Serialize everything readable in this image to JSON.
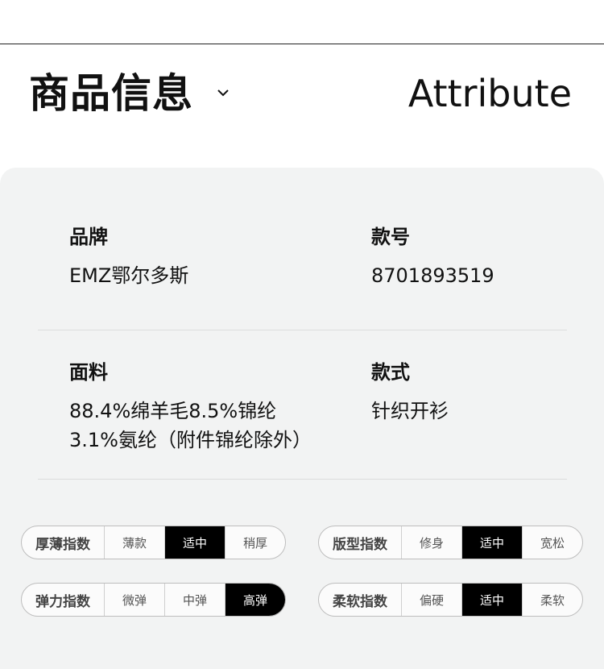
{
  "header": {
    "title": "商品信息",
    "title_en": "Attribute",
    "toggle_icon": "chevron-down-icon"
  },
  "attributes": [
    {
      "label": "品牌",
      "value": "EMZ鄂尔多斯"
    },
    {
      "label": "款号",
      "value": "8701893519"
    },
    {
      "label": "面料",
      "value_lines": [
        "88.4%绵羊毛8.5%锦纶",
        "3.1%氨纶（附件锦纶除外）"
      ]
    },
    {
      "label": "款式",
      "value": "针织开衫"
    }
  ],
  "indices": [
    {
      "name": "厚薄指数",
      "options": [
        "薄款",
        "适中",
        "稍厚"
      ],
      "selected": "适中"
    },
    {
      "name": "版型指数",
      "options": [
        "修身",
        "适中",
        "宽松"
      ],
      "selected": "适中"
    },
    {
      "name": "弹力指数",
      "options": [
        "微弹",
        "中弹",
        "高弹"
      ],
      "selected": "高弹"
    },
    {
      "name": "柔软指数",
      "options": [
        "偏硬",
        "适中",
        "柔软"
      ],
      "selected": "适中"
    }
  ],
  "colors": {
    "panel_bg": "#f2f3f3",
    "selected_bg": "#000000",
    "selected_text": "#ffffff"
  }
}
